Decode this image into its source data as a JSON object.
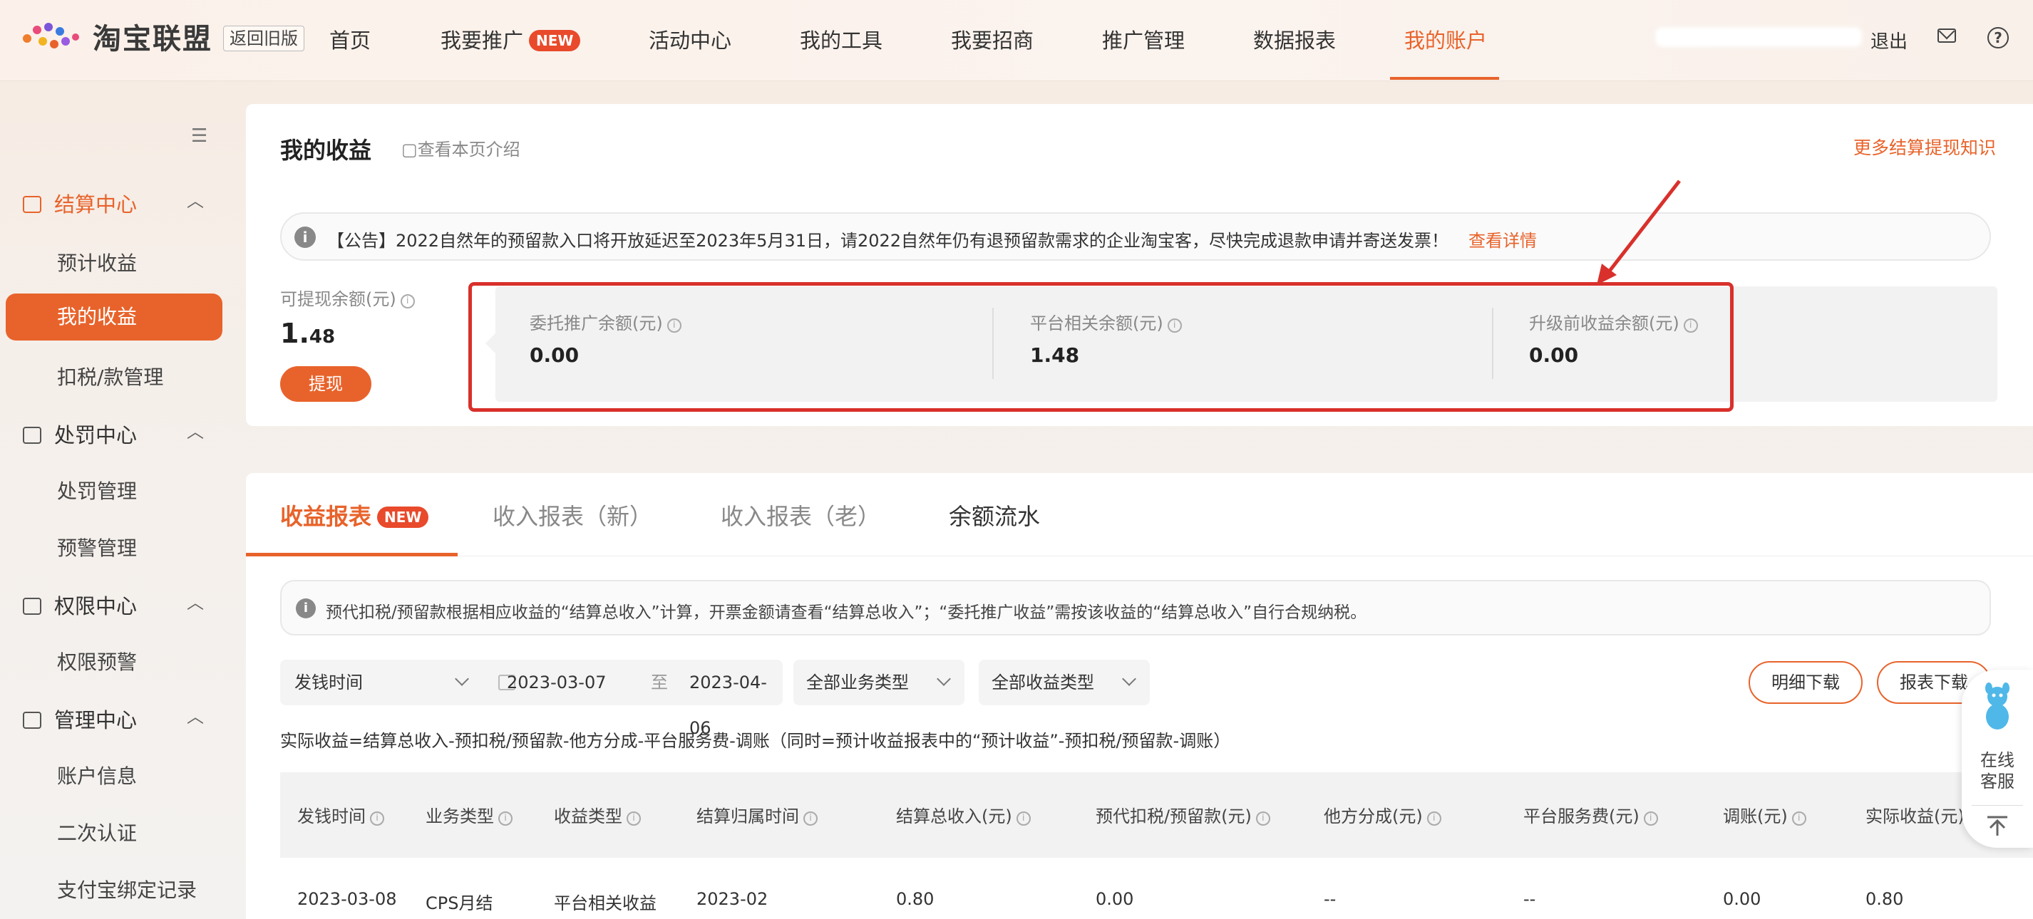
{
  "header": {
    "logo_text": "淘宝联盟",
    "old_version": "返回旧版",
    "nav": [
      {
        "label": "首页"
      },
      {
        "label": "我要推广",
        "badge": "NEW"
      },
      {
        "label": "活动中心"
      },
      {
        "label": "我的工具"
      },
      {
        "label": "我要招商"
      },
      {
        "label": "推广管理"
      },
      {
        "label": "数据报表"
      },
      {
        "label": "我的账户",
        "active": true
      }
    ],
    "logout": "退出",
    "icons": [
      "mail-icon",
      "help-icon"
    ]
  },
  "sidebar": {
    "groups": [
      {
        "label": "结算中心",
        "active": true,
        "items": [
          "预计收益",
          "我的收益",
          "扣税/款管理"
        ]
      },
      {
        "label": "处罚中心",
        "items": [
          "处罚管理",
          "预警管理"
        ]
      },
      {
        "label": "权限中心",
        "items": [
          "权限预警"
        ]
      },
      {
        "label": "管理中心",
        "items": [
          "账户信息",
          "二次认证",
          "支付宝绑定记录"
        ]
      }
    ],
    "active_item": "我的收益"
  },
  "earnings": {
    "title": "我的收益",
    "intro_link": "查看本页介绍",
    "more_link": "更多结算提现知识",
    "notice": "【公告】2022自然年的预留款入口将开放延迟至2023年5月31日，请2022自然年仍有退预留款需求的企业淘宝客，尽快完成退款申请并寄送发票！",
    "notice_link": "查看详情",
    "withdrawable_label": "可提现余额(元)",
    "withdrawable_int": "1.",
    "withdrawable_dec": "48",
    "withdraw_button": "提现",
    "balances": [
      {
        "label": "委托推广余额(元)",
        "value": "0.00"
      },
      {
        "label": "平台相关余额(元)",
        "value": "1.48"
      },
      {
        "label": "升级前收益余额(元)",
        "value": "0.00"
      }
    ],
    "highlight_color": "#d9302b"
  },
  "reports": {
    "tabs": [
      {
        "label": "收益报表",
        "badge": "NEW",
        "active": true
      },
      {
        "label": "收入报表（新）"
      },
      {
        "label": "收入报表（老）"
      },
      {
        "label": "余额流水"
      }
    ],
    "tip": "预代扣税/预留款根据相应收益的“结算总收入”计算，开票金额请查看“结算总收入”；“委托推广收益”需按该收益的“结算总收入”自行合规纳税。",
    "filters": {
      "time_type": "发钱时间",
      "date_from": "2023-03-07",
      "date_sep": "至",
      "date_to": "2023-04-06",
      "business_type": "全部业务类型",
      "income_type": "全部收益类型"
    },
    "buttons": {
      "detail_download": "明细下载",
      "report_download": "报表下载"
    },
    "formula": "实际收益=结算总收入-预扣税/预留款-他方分成-平台服务费-调账（同时=预计收益报表中的“预计收益”-预扣税/预留款-调账）",
    "columns": [
      "发钱时间",
      "业务类型",
      "收益类型",
      "结算归属时间",
      "结算总收入(元)",
      "预代扣税/预留款(元)",
      "他方分成(元)",
      "平台服务费(元)",
      "调账(元)",
      "实际收益(元)"
    ],
    "rows": [
      [
        "2023-03-08",
        "CPS月结",
        "平台相关收益",
        "2023-02",
        "0.80",
        "0.00",
        "--",
        "--",
        "0.00",
        "0.80"
      ]
    ]
  },
  "service": {
    "label": "在线客服"
  },
  "colors": {
    "accent": "#e8632b",
    "badge": "#e84a2b"
  }
}
